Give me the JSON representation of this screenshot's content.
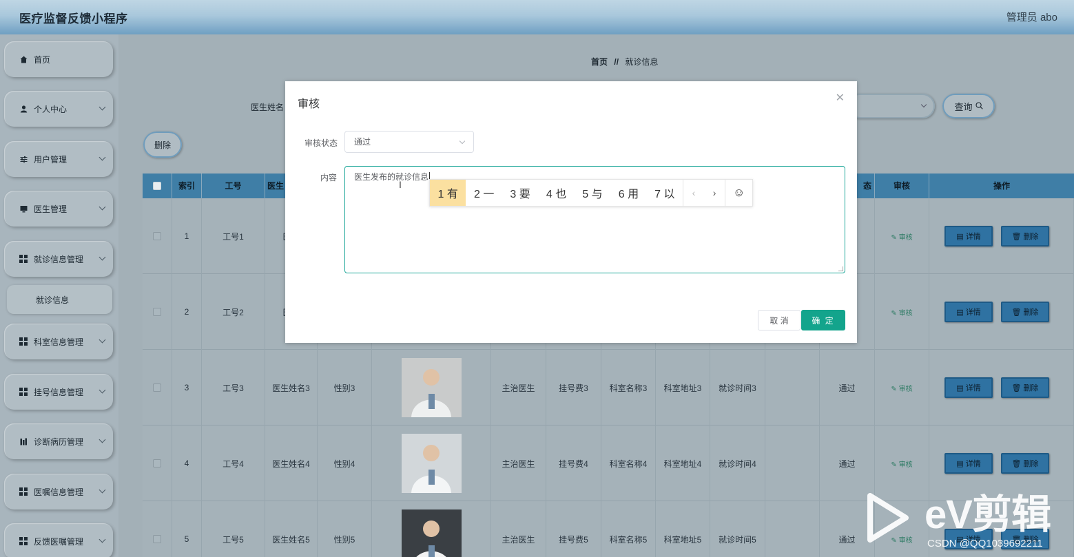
{
  "header": {
    "title": "医疗监督反馈小程序",
    "admin": "管理员 abo"
  },
  "sidebar": {
    "items": [
      {
        "label": "首页",
        "icon": "home-icon"
      },
      {
        "label": "个人中心",
        "icon": "user-icon"
      },
      {
        "label": "用户管理",
        "icon": "sliders-icon"
      },
      {
        "label": "医生管理",
        "icon": "monitor-icon"
      },
      {
        "label": "就诊信息管理",
        "icon": "grid-icon"
      },
      {
        "label": "科室信息管理",
        "icon": "grid-icon"
      },
      {
        "label": "挂号信息管理",
        "icon": "grid-icon"
      },
      {
        "label": "诊断病历管理",
        "icon": "chart-icon"
      },
      {
        "label": "医嘱信息管理",
        "icon": "grid-icon"
      },
      {
        "label": "反馈医嘱管理",
        "icon": "grid-icon"
      }
    ],
    "sub_item": "就诊信息"
  },
  "breadcrumb": {
    "home": "首页",
    "sep": "//",
    "current": "就诊信息"
  },
  "filter": {
    "label": "医生姓名",
    "query_label": "查询"
  },
  "toolbar": {
    "delete_label": "删除"
  },
  "table": {
    "headers": [
      "索引",
      "工号",
      "医生",
      "态",
      "审核",
      "操作"
    ],
    "rows": [
      {
        "index": "1",
        "id": "工号1",
        "name": "医生",
        "gender": "",
        "title": "",
        "fee": "",
        "dept": "",
        "addr": "",
        "time": "",
        "status": ""
      },
      {
        "index": "2",
        "id": "工号2",
        "name": "医生",
        "gender": "",
        "title": "",
        "fee": "",
        "dept": "",
        "addr": "",
        "time": "",
        "status": ""
      },
      {
        "index": "3",
        "id": "工号3",
        "name": "医生姓名3",
        "gender": "性别3",
        "title": "主治医生",
        "fee": "挂号费3",
        "dept": "科室名称3",
        "addr": "科室地址3",
        "time": "就诊时间3",
        "status": "通过"
      },
      {
        "index": "4",
        "id": "工号4",
        "name": "医生姓名4",
        "gender": "性别4",
        "title": "主治医生",
        "fee": "挂号费4",
        "dept": "科室名称4",
        "addr": "科室地址4",
        "time": "就诊时间4",
        "status": "通过"
      },
      {
        "index": "5",
        "id": "工号5",
        "name": "医生姓名5",
        "gender": "性别5",
        "title": "主治医生",
        "fee": "挂号费5",
        "dept": "科室名称5",
        "addr": "科室地址5",
        "time": "就诊时间5",
        "status": "通过"
      }
    ],
    "audit_label": "审核",
    "detail_label": "详情",
    "delete_label": "删除"
  },
  "modal": {
    "title": "审核",
    "status_label": "审核状态",
    "status_value": "通过",
    "content_label": "内容",
    "content_value": "医生发布的就诊信息",
    "ime_candidates": [
      "1 有",
      "2 一",
      "3 要",
      "4 也",
      "5 与",
      "6 用",
      "7 以"
    ],
    "cancel_label": "取 消",
    "ok_label": "确 定"
  },
  "watermark": {
    "brand": "eV剪辑",
    "csdn": "CSDN @QQ1039692211"
  },
  "colors": {
    "primary": "#13a48c",
    "header_blue": "#3f7ea6",
    "overlay": "#a3b0b7"
  }
}
